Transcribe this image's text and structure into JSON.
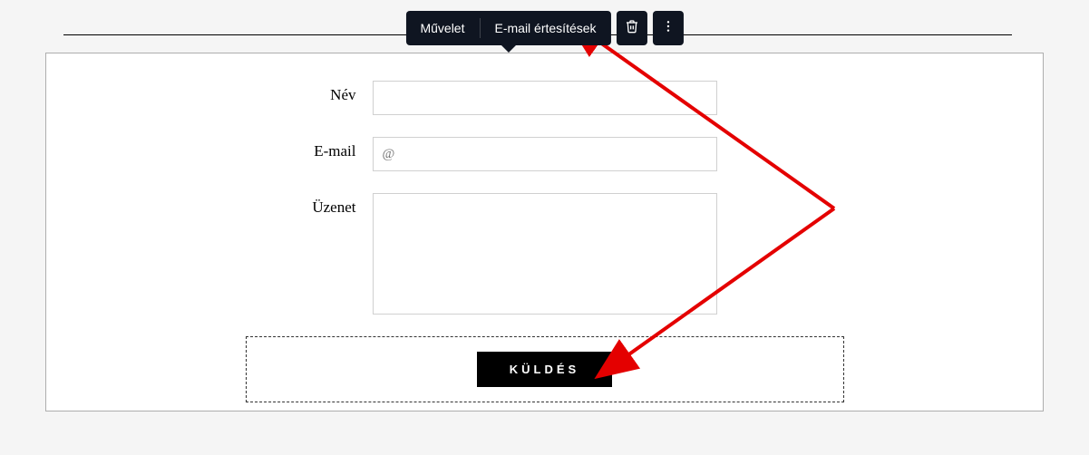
{
  "toolbar": {
    "tab_action": "Művelet",
    "tab_email": "E-mail értesítések"
  },
  "form": {
    "name_label": "Név",
    "name_value": "",
    "email_label": "E-mail",
    "email_placeholder": "@",
    "email_value": "",
    "message_label": "Üzenet",
    "message_value": "",
    "submit_label": "KÜLDÉS"
  }
}
